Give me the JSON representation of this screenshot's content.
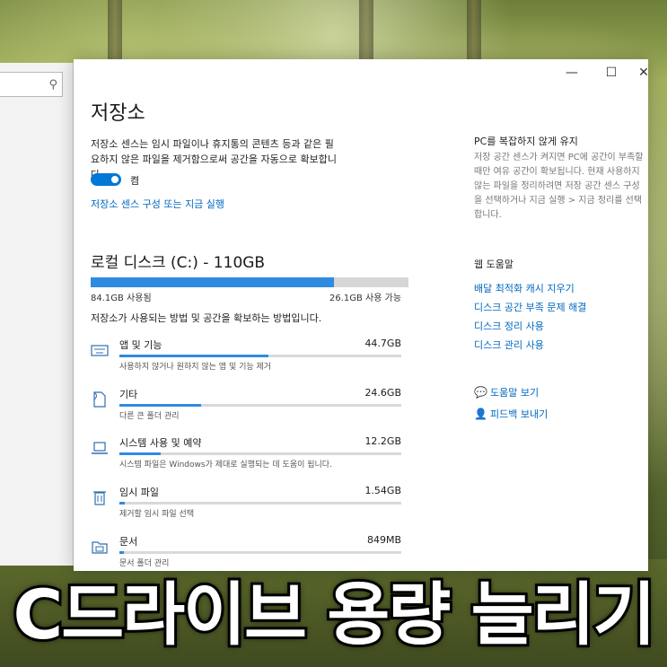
{
  "window": {
    "title": "저장소",
    "controls": {
      "minimize": "—",
      "maximize": "☐",
      "close": "✕"
    }
  },
  "storage_sense": {
    "description": "저장소 센스는 임시 파일이나 휴지통의 콘텐츠 등과 같은 필요하지 않은 파일을 제거함으로써 공간을 자동으로 확보합니다.",
    "toggle_state": "켬",
    "toggle_on": true,
    "configure_link": "저장소 센스 구성 또는 지금 실행"
  },
  "drive": {
    "title": "로컬 디스크 (C:) - 110GB",
    "used_label": "84.1GB 사용됨",
    "free_label": "26.1GB 사용 가능",
    "used_fraction": 0.765,
    "description": "저장소가 사용되는 방법 및 공간을 확보하는 방법입니다."
  },
  "categories": [
    {
      "name": "앱 및 기능",
      "size": "44.7GB",
      "sub": "사용하지 않거나 원하지 않는 앱 및 기능 제거",
      "fraction": 0.53,
      "icon": "keyboard-icon"
    },
    {
      "name": "기타",
      "size": "24.6GB",
      "sub": "다른 큰 폴더 관리",
      "fraction": 0.29,
      "icon": "document-icon"
    },
    {
      "name": "시스템 사용 및 예약",
      "size": "12.2GB",
      "sub": "시스템 파일은 Windows가 제대로 실행되는 데 도움이 됩니다.",
      "fraction": 0.145,
      "icon": "laptop-icon"
    },
    {
      "name": "임시 파일",
      "size": "1.54GB",
      "sub": "제거할 임시 파일 선택",
      "fraction": 0.02,
      "icon": "trash-icon"
    },
    {
      "name": "문서",
      "size": "849MB",
      "sub": "문서 폴더 관리",
      "fraction": 0.01,
      "icon": "folder-icon"
    }
  ],
  "right_panel": {
    "heading": "PC를 복잡하지 않게 유지",
    "text": "저장 공간 센스가 켜지면 PC에 공간이 부족할 때만 여유 공간이 확보됩니다. 현재 사용하지 않는 파일을 정리하려면 저장 공간 센스 구성을 선택하거나 지금 실행 > 지금 정리를 선택합니다.",
    "help_heading": "웹 도움말",
    "links": [
      "배달 최적화 캐시 지우기",
      "디스크 공간 부족 문제 해결",
      "디스크 정리 사용",
      "디스크 관리 사용"
    ],
    "get_help": "도움말 보기",
    "feedback": "피드백 보내기"
  },
  "banner": {
    "text": "C드라이브 용량 늘리기"
  },
  "colors": {
    "accent": "#0078d7",
    "bar_fill": "#2e8be0",
    "link": "#0067c0"
  }
}
